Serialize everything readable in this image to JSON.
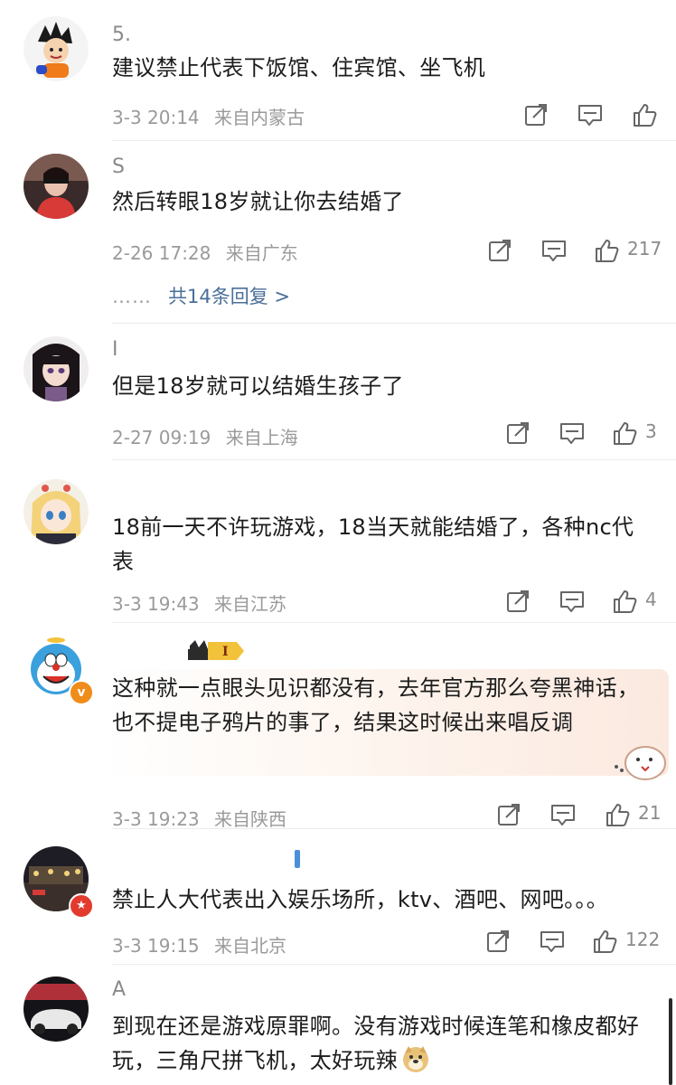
{
  "comments": [
    {
      "username": "5.",
      "text": "建议禁止代表下饭馆、住宾馆、坐飞机",
      "time": "3-3 20:14",
      "location": "来自内蒙古",
      "like_count": ""
    },
    {
      "username": "S",
      "text": "然后转眼18岁就让你去结婚了",
      "time": "2-26 17:28",
      "location": "来自广东",
      "like_count": "217",
      "replies": {
        "dots": "……",
        "label": "共14条回复 >"
      }
    },
    {
      "username": "I",
      "text": "但是18岁就可以结婚生孩子了",
      "time": "2-27 09:19",
      "location": "来自上海",
      "like_count": "3"
    },
    {
      "username": "",
      "text": "18前一天不许玩游戏，18当天就能结婚了，各种nc代表",
      "time": "3-3 19:43",
      "location": "来自江苏",
      "like_count": "4"
    },
    {
      "username": "",
      "text": "这种就一点眼头见识都没有，去年官方那么夸黑神话，也不提电子鸦片的事了，结果这时候出来唱反调",
      "time": "3-3 19:23",
      "location": "来自陕西",
      "like_count": "21",
      "level_badge": "I",
      "verified_mark": "v"
    },
    {
      "username": "",
      "text": "禁止人大代表出入娱乐场所，ktv、酒吧、网吧。。。",
      "time": "3-3 19:15",
      "location": "来自北京",
      "like_count": "122"
    },
    {
      "username": "A",
      "text": "到现在还是游戏原罪啊。没有游戏时候连笔和橡皮都好玩，三角尺拼飞机，太好玩辣",
      "time": "",
      "location": "",
      "like_count": ""
    }
  ],
  "colors": {
    "text": "#1c1c1c",
    "meta": "#9a9a9a",
    "link": "#4a6e9a",
    "verified_badge": "#f08c1a",
    "divider": "#ececec"
  },
  "icons": {
    "repost": "repost-icon",
    "comment": "comment-icon",
    "like": "like-icon"
  }
}
